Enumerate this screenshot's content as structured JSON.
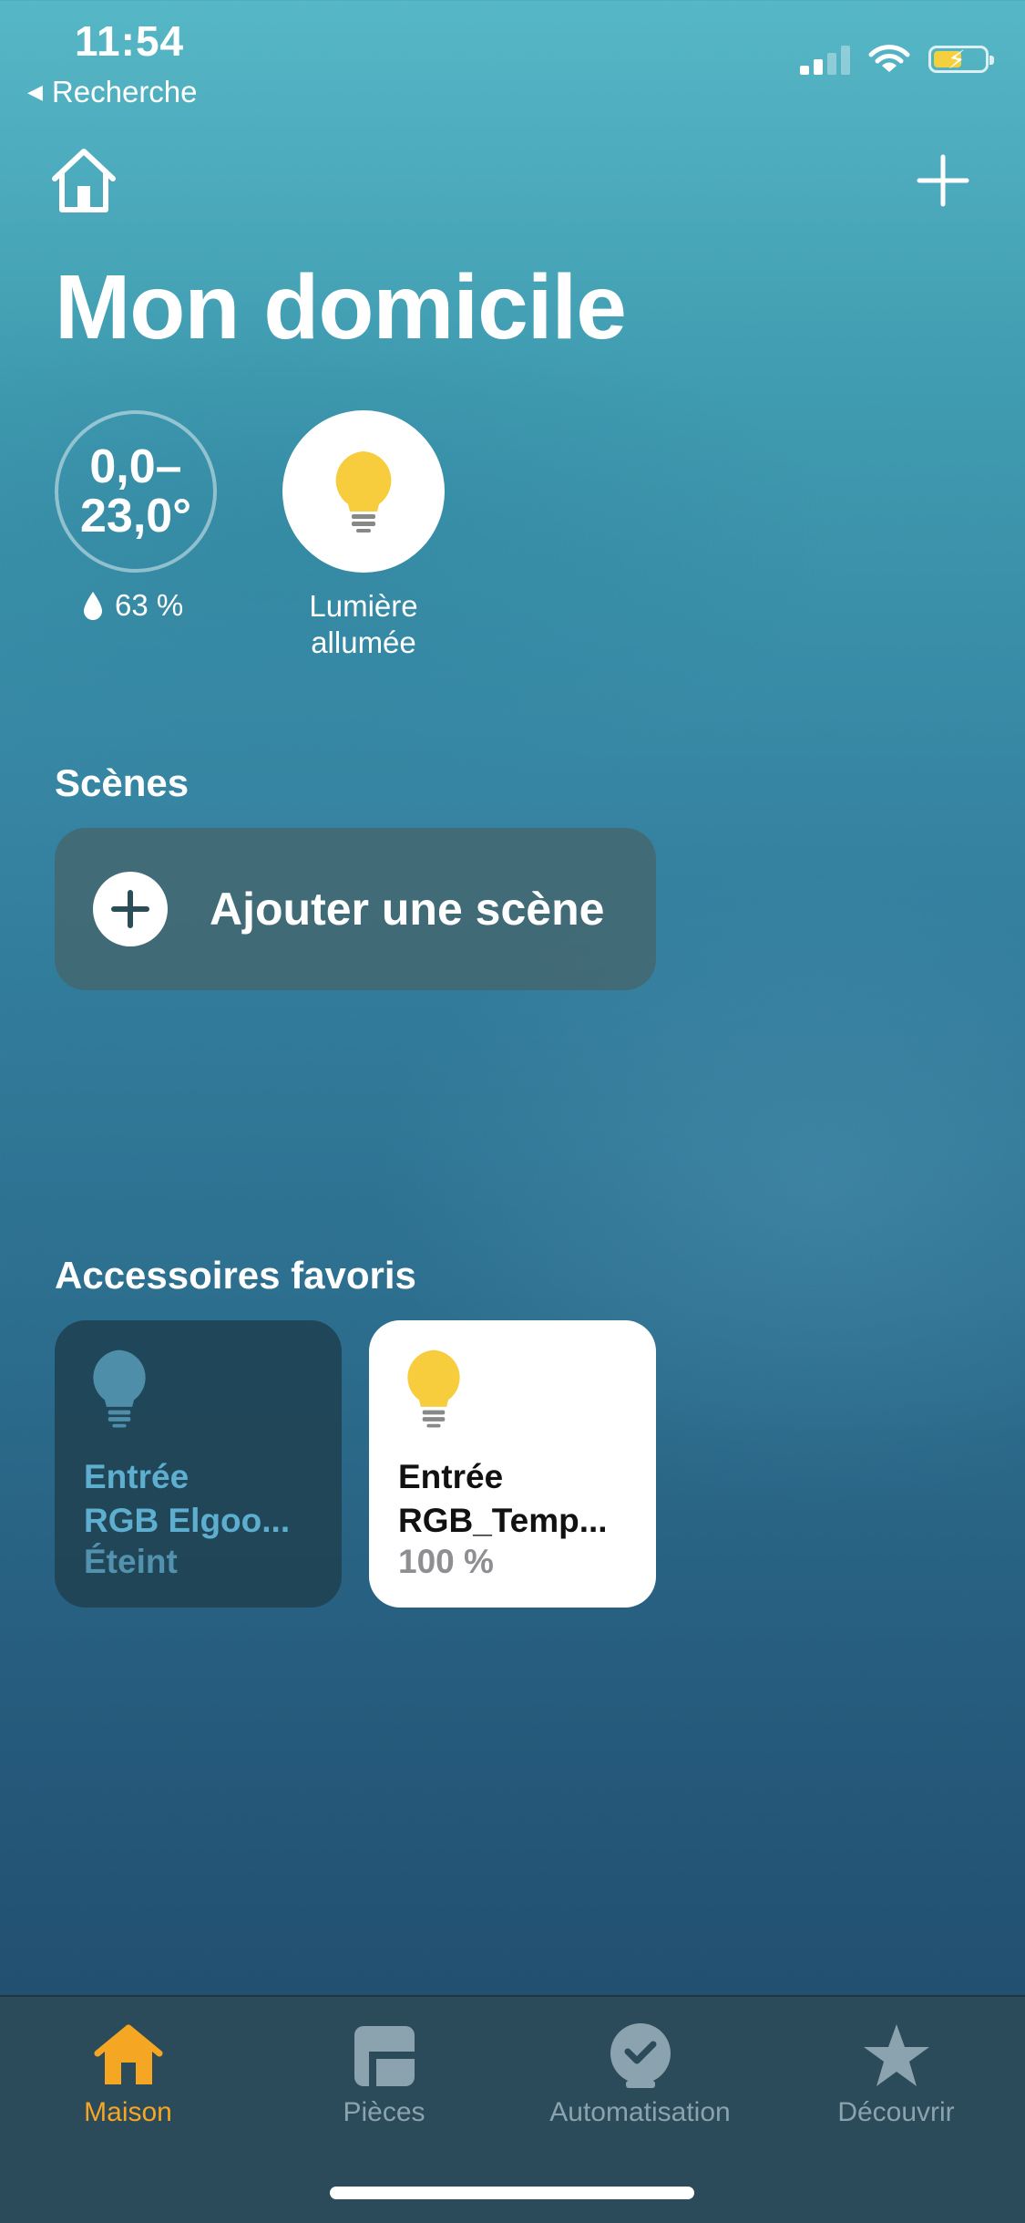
{
  "status_bar": {
    "time": "11:54",
    "back_label": "Recherche"
  },
  "header": {
    "title": "Mon domicile"
  },
  "summary": {
    "temperature": "0,0–23,0°",
    "temperature_line1": "0,0–",
    "temperature_line2": "23,0°",
    "humidity": "63 %",
    "light_line1": "Lumière",
    "light_line2": "allumée"
  },
  "scenes": {
    "title": "Scènes",
    "add_label": "Ajouter une scène"
  },
  "favorites": {
    "title": "Accessoires favoris",
    "items": [
      {
        "name_line1": "Entrée",
        "name_line2": "RGB Elgoo...",
        "state": "Éteint",
        "on": false
      },
      {
        "name_line1": "Entrée",
        "name_line2": "RGB_Temp...",
        "state": "100 %",
        "on": true
      }
    ]
  },
  "tabbar": {
    "tabs": [
      {
        "label": "Maison",
        "icon": "house-icon",
        "active": true
      },
      {
        "label": "Pièces",
        "icon": "rooms-icon",
        "active": false
      },
      {
        "label": "Automatisation",
        "icon": "automation-clock-icon",
        "active": false
      },
      {
        "label": "Découvrir",
        "icon": "star-icon",
        "active": false
      }
    ],
    "active_color": "#f5a623",
    "inactive_color": "#8aa3ae"
  },
  "colors": {
    "bulb_on": "#f7cd3e",
    "bulb_off": "#4f8ea8",
    "battery": "#f4d03f"
  }
}
